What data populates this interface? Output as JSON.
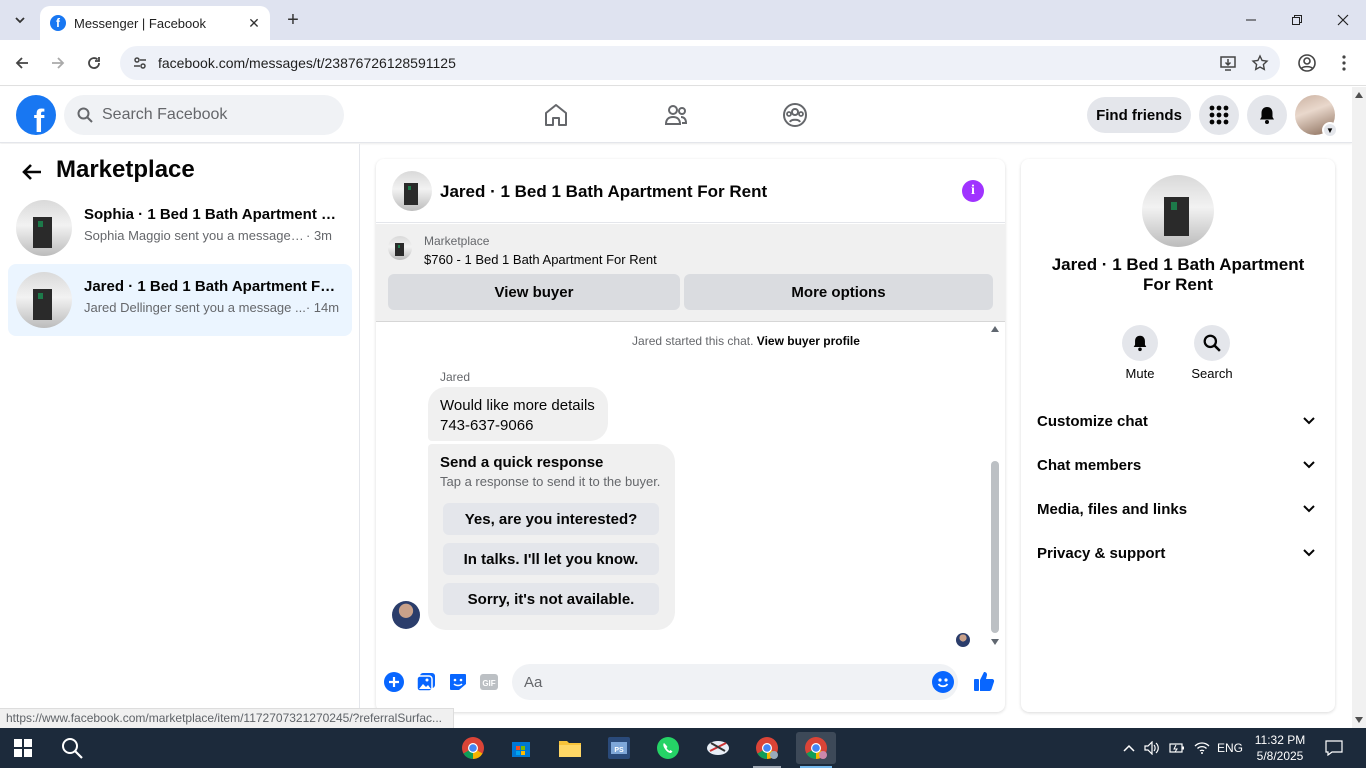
{
  "browser": {
    "tab_title": "Messenger | Facebook",
    "url": "facebook.com/messages/t/23876726128591125",
    "status_url": "https://www.facebook.com/marketplace/item/1172707321270245/?referralSurfac..."
  },
  "header": {
    "logo": "f",
    "search_placeholder": "Search Facebook",
    "find_friends": "Find friends"
  },
  "sidebar": {
    "title": "Marketplace",
    "conversations": [
      {
        "name": "Sophia · 1 Bed 1 Bath Apartment F...",
        "preview": "Sophia Maggio sent you a message a...",
        "time": "· 3m"
      },
      {
        "name": "Jared · 1 Bed 1 Bath Apartment For...",
        "preview": "Jared Dellinger sent you a message ...",
        "time": "· 14m"
      }
    ]
  },
  "chat": {
    "title": "Jared · 1 Bed 1 Bath Apartment For Rent",
    "info_glyph": "i",
    "marketplace_label": "Marketplace",
    "listing": "$760 - 1 Bed 1 Bath Apartment For Rent",
    "view_buyer": "View buyer",
    "more_options": "More options",
    "started_text": "Jared started this chat.",
    "view_profile": "View buyer profile",
    "sender": "Jared",
    "message_line1": "Would like more details",
    "message_line2": "743-637-9066",
    "quick_title": "Send a quick response",
    "quick_sub": "Tap a response to send it to the buyer.",
    "quick_responses": [
      "Yes, are you interested?",
      "In talks. I'll let you know.",
      "Sorry, it's not available."
    ],
    "composer_placeholder": "Aa"
  },
  "info_panel": {
    "name": "Jared · 1 Bed 1 Bath Apartment For Rent",
    "mute": "Mute",
    "search": "Search",
    "sections": [
      "Customize chat",
      "Chat members",
      "Media, files and links",
      "Privacy & support"
    ]
  },
  "taskbar": {
    "language": "ENG",
    "time": "11:32 PM",
    "date": "5/8/2025"
  },
  "colors": {
    "fb_blue": "#1877f2",
    "messenger_blue": "#0866ff",
    "info_purple": "#a033ff",
    "active_conv": "#ebf5ff"
  }
}
